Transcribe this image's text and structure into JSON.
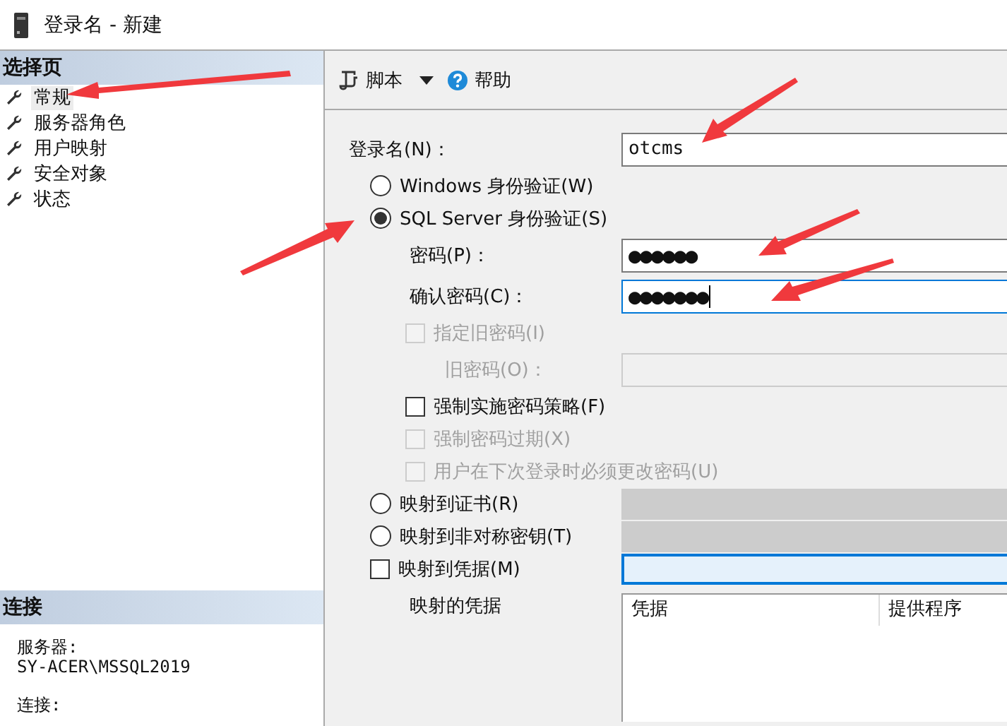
{
  "window": {
    "title": "登录名 - 新建"
  },
  "sidebar": {
    "title": "选择页",
    "items": [
      {
        "label": "常规",
        "selected": true
      },
      {
        "label": "服务器角色",
        "selected": false
      },
      {
        "label": "用户映射",
        "selected": false
      },
      {
        "label": "安全对象",
        "selected": false
      },
      {
        "label": "状态",
        "selected": false
      }
    ]
  },
  "connection": {
    "title": "连接",
    "groups": [
      {
        "label": "服务器:",
        "value": "SY-ACER\\MSSQL2019"
      },
      {
        "label": "连接:"
      }
    ]
  },
  "toolbar": {
    "items": [
      {
        "kind": "script",
        "label": "脚本"
      },
      {
        "kind": "dropdown"
      },
      {
        "kind": "help",
        "label": "帮助"
      }
    ]
  },
  "form": {
    "rows": [
      {
        "kind": "field",
        "label": "登录名(N)：",
        "value": "otcms",
        "secret": false,
        "focused": false,
        "disabled": false
      },
      {
        "kind": "radio",
        "label": "Windows 身份验证(W)",
        "selected": false
      },
      {
        "kind": "radio",
        "label": "SQL Server 身份验证(S)",
        "selected": true,
        "children": [
          {
            "kind": "field",
            "label": "密码(P)：",
            "value": "●●●●●●",
            "secret": true,
            "focused": false,
            "disabled": false
          },
          {
            "kind": "field",
            "label": "确认密码(C)：",
            "value": "●●●●●●●",
            "secret": true,
            "focused": true,
            "disabled": false
          },
          {
            "kind": "checkbox",
            "label": "指定旧密码(I)",
            "checked": false,
            "disabled": true,
            "children": [
              {
                "kind": "field",
                "label": "旧密码(O)：",
                "focused": false,
                "disabled": true
              }
            ]
          },
          {
            "kind": "checkbox",
            "label": "强制实施密码策略(F)",
            "checked": false,
            "disabled": false
          },
          {
            "kind": "checkbox",
            "label": "强制密码过期(X)",
            "checked": false,
            "disabled": true
          },
          {
            "kind": "checkbox",
            "label": "用户在下次登录时必须更改密码(U)",
            "checked": false,
            "disabled": true
          }
        ]
      },
      {
        "kind": "radio",
        "label": "映射到证书(R)",
        "selected": false,
        "combo": {
          "disabled": true,
          "focused": false
        }
      },
      {
        "kind": "radio",
        "label": "映射到非对称密钥(T)",
        "selected": false,
        "combo": {
          "disabled": true,
          "focused": false
        }
      },
      {
        "kind": "checkbox",
        "label": "映射到凭据(M)",
        "checked": false,
        "disabled": false,
        "combo": {
          "disabled": false,
          "focused": true
        }
      },
      {
        "kind": "table",
        "label": "映射的凭据",
        "columns": [
          "凭据",
          "提供程序"
        ]
      }
    ]
  }
}
